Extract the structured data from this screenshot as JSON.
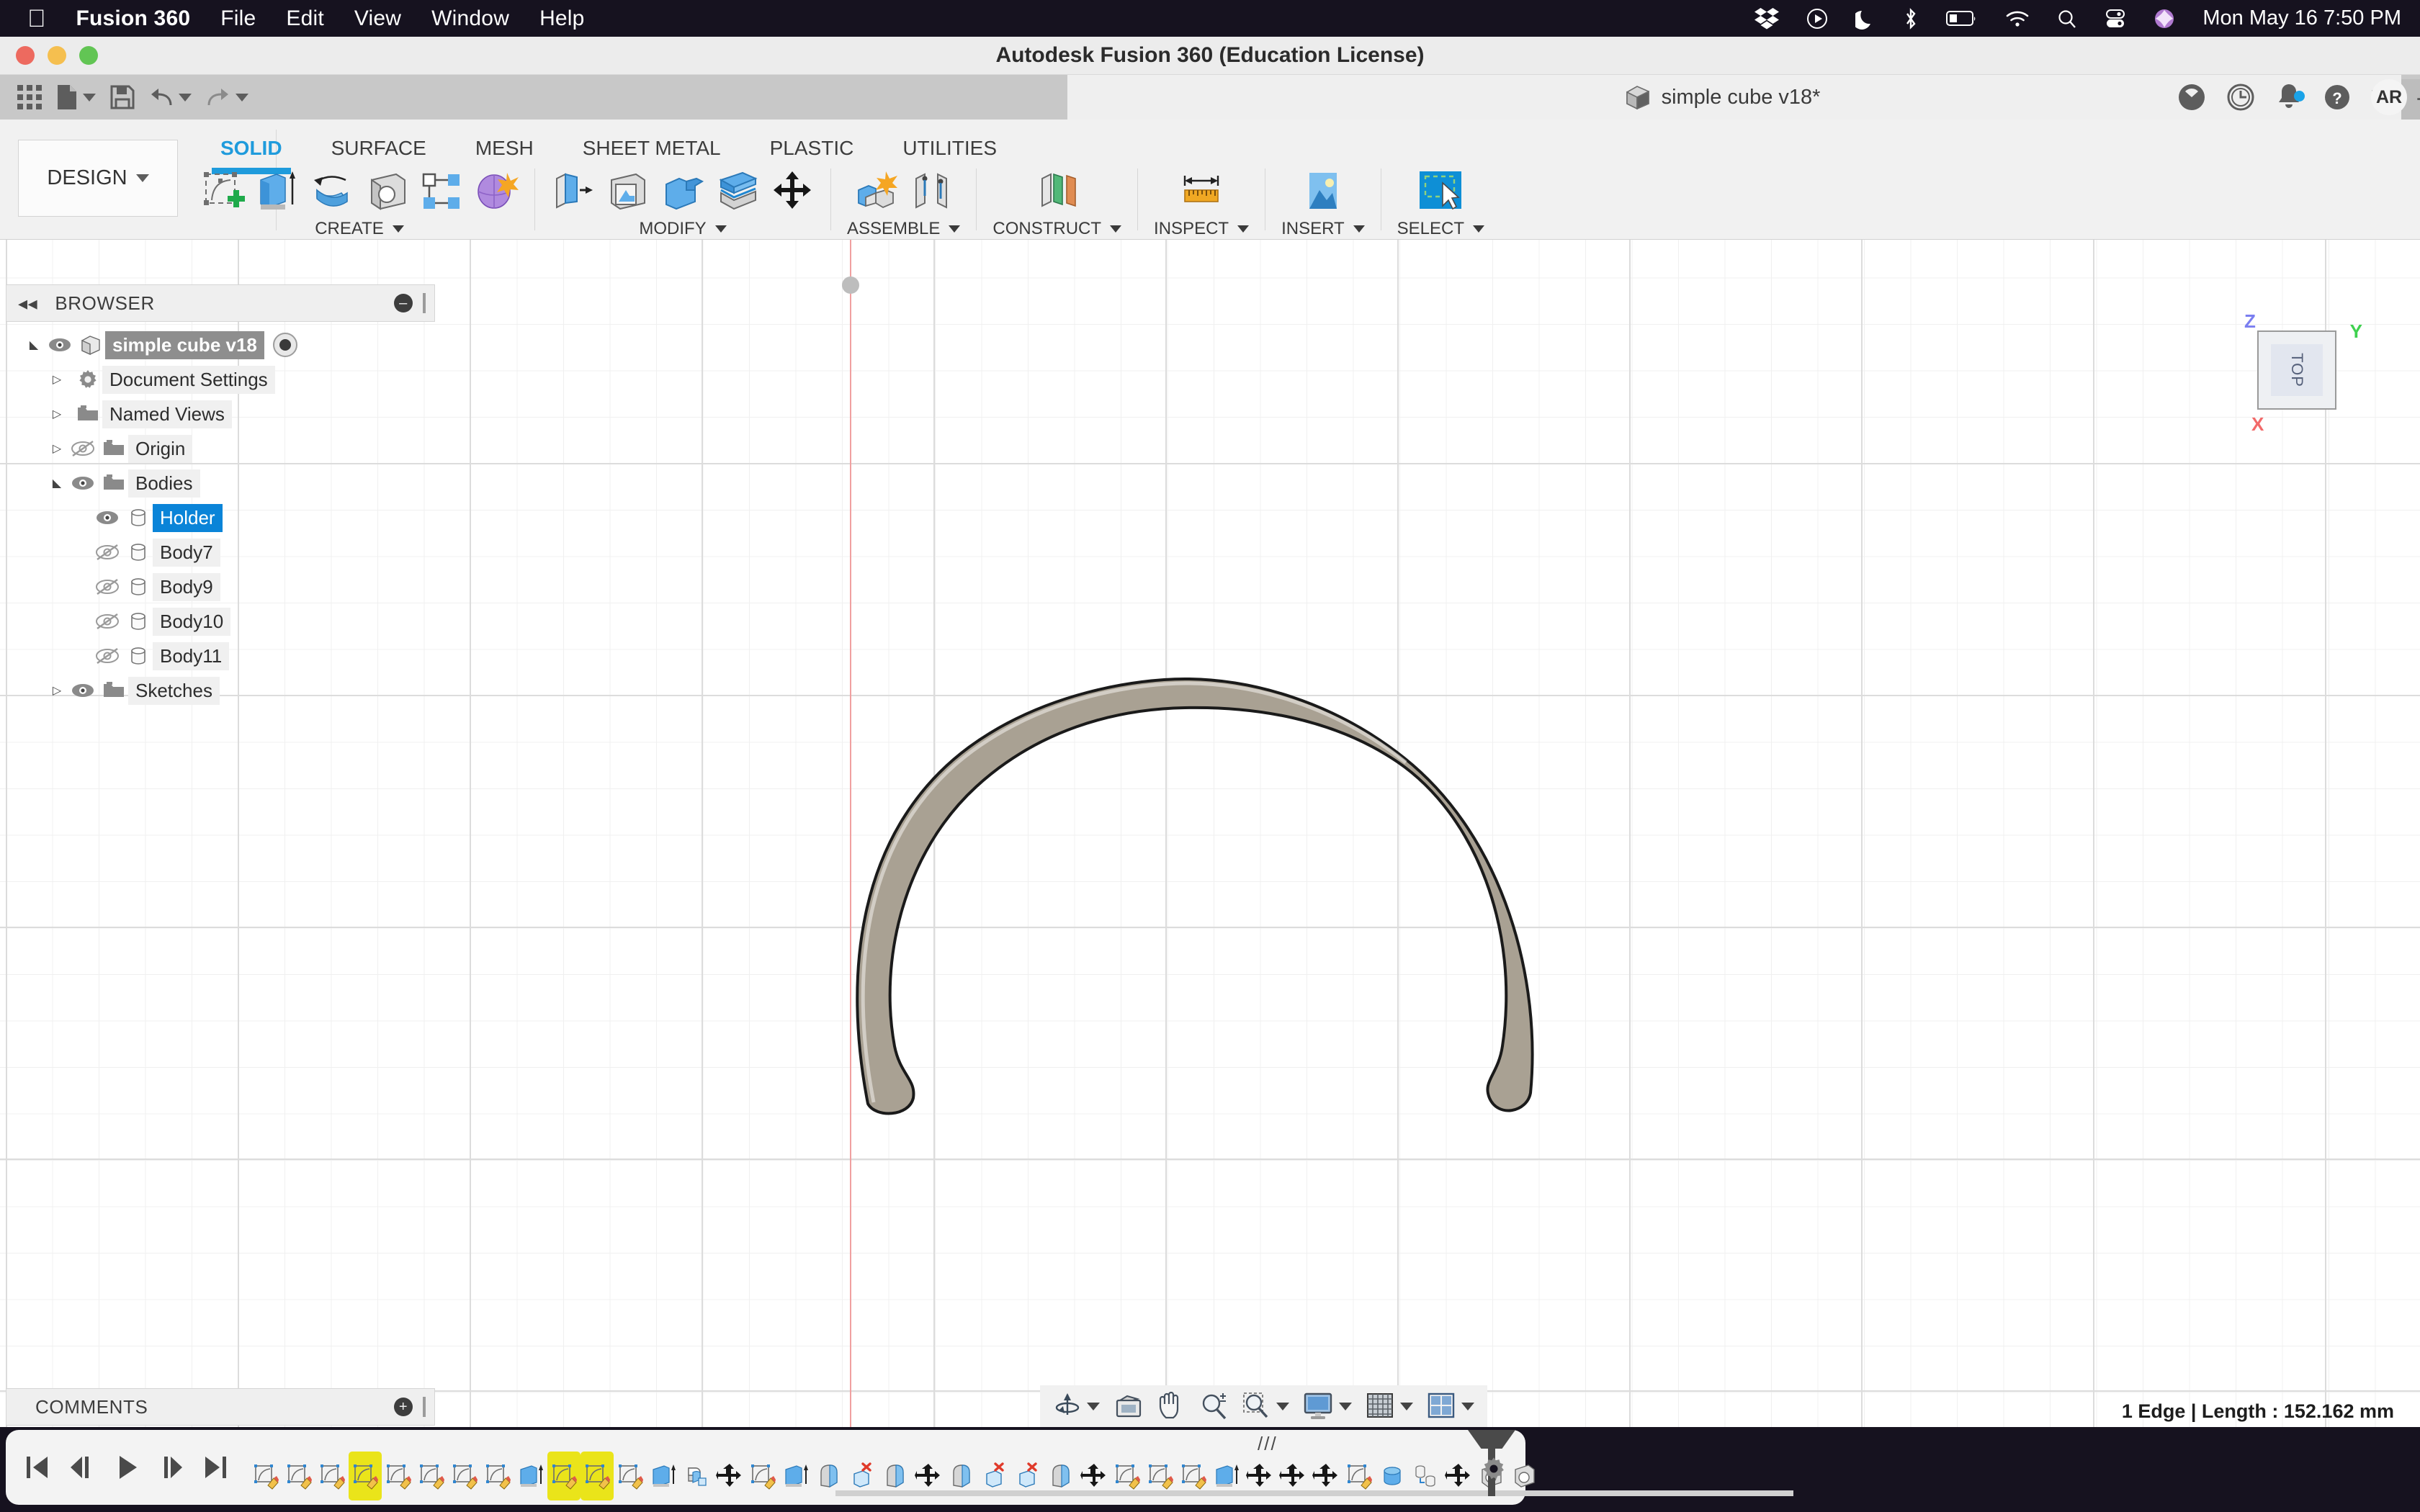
{
  "macos_menu": {
    "apple_icon": "apple-icon",
    "app_name": "Fusion 360",
    "items": [
      "File",
      "Edit",
      "View",
      "Window",
      "Help"
    ],
    "status_icons": [
      "dropbox-icon",
      "play-circle-icon",
      "moon-icon",
      "bluetooth-icon",
      "battery-icon",
      "wifi-icon",
      "search-icon",
      "control-center-icon",
      "siri-icon"
    ],
    "datetime": "Mon May 16  7:50 PM"
  },
  "window": {
    "title": "Autodesk Fusion 360 (Education License)",
    "traffic_lights": [
      "close",
      "minimize",
      "zoom"
    ]
  },
  "quick_access": {
    "items": [
      {
        "name": "show-data-panel-icon",
        "label": "Data Panel"
      },
      {
        "name": "file-icon",
        "label": "File"
      },
      {
        "name": "save-icon",
        "label": "Save"
      },
      {
        "name": "undo-icon",
        "label": "Undo"
      },
      {
        "name": "redo-icon",
        "label": "Redo"
      }
    ],
    "document_tab": "simple cube v18*",
    "document_tab_icon": "cube-icon",
    "close_tab": "✕",
    "new_tab": "+",
    "right_icons": [
      "extension-icon",
      "job-status-clock-icon",
      "notifications-bell-icon",
      "help-icon"
    ],
    "avatar_initials": "AR"
  },
  "ribbon": {
    "workspace": "DESIGN",
    "tabs": [
      {
        "label": "SOLID",
        "active": true
      },
      {
        "label": "SURFACE",
        "active": false
      },
      {
        "label": "MESH",
        "active": false
      },
      {
        "label": "SHEET METAL",
        "active": false
      },
      {
        "label": "PLASTIC",
        "active": false
      },
      {
        "label": "UTILITIES",
        "active": false
      }
    ],
    "groups": [
      {
        "label": "CREATE",
        "icons": [
          "create-sketch-icon",
          "extrude-icon",
          "revolve-icon",
          "hole-icon",
          "pattern-icon",
          "create-form-icon"
        ]
      },
      {
        "label": "MODIFY",
        "icons": [
          "press-pull-icon",
          "shell-icon",
          "combine-icon",
          "offset-face-icon",
          "move-copy-icon"
        ]
      },
      {
        "label": "ASSEMBLE",
        "icons": [
          "new-component-icon",
          "joint-icon"
        ]
      },
      {
        "label": "CONSTRUCT",
        "icons": [
          "offset-plane-icon"
        ]
      },
      {
        "label": "INSPECT",
        "icons": [
          "measure-icon"
        ]
      },
      {
        "label": "INSERT",
        "icons": [
          "insert-image-icon"
        ]
      },
      {
        "label": "SELECT",
        "icons": [
          "select-icon"
        ]
      }
    ]
  },
  "browser": {
    "title": "BROWSER",
    "collapse_icon": "collapse-left-icon",
    "pin_icon": "minimize-panel-icon",
    "tree": [
      {
        "label": "simple cube v18",
        "icon": "component-cube-icon",
        "visible": true,
        "expanded": true,
        "indent": 0,
        "root": true,
        "radio": true
      },
      {
        "label": "Document Settings",
        "icon": "gear-icon",
        "visible": null,
        "expanded": false,
        "indent": 1
      },
      {
        "label": "Named Views",
        "icon": "folder-icon",
        "visible": null,
        "expanded": false,
        "indent": 1
      },
      {
        "label": "Origin",
        "icon": "folder-icon",
        "visible": false,
        "expanded": false,
        "indent": 1
      },
      {
        "label": "Bodies",
        "icon": "folder-icon",
        "visible": true,
        "expanded": true,
        "indent": 1
      },
      {
        "label": "Holder",
        "icon": "body-icon",
        "visible": true,
        "expanded": null,
        "indent": 2,
        "selected": true
      },
      {
        "label": "Body7",
        "icon": "body-icon",
        "visible": false,
        "expanded": null,
        "indent": 2
      },
      {
        "label": "Body9",
        "icon": "body-icon",
        "visible": false,
        "expanded": null,
        "indent": 2
      },
      {
        "label": "Body10",
        "icon": "body-icon",
        "visible": false,
        "expanded": null,
        "indent": 2
      },
      {
        "label": "Body11",
        "icon": "body-icon",
        "visible": false,
        "expanded": null,
        "indent": 2
      },
      {
        "label": "Sketches",
        "icon": "folder-icon",
        "visible": true,
        "expanded": false,
        "indent": 1
      }
    ]
  },
  "comments": {
    "title": "COMMENTS",
    "pin_icon": "minimize-panel-icon"
  },
  "viewcube": {
    "face_label": "TOP",
    "axis_z": "Z",
    "axis_y": "Y",
    "axis_x": "X",
    "colors": {
      "z": "#7a7ef0",
      "y": "#3fd14f",
      "x": "#f26a6a"
    }
  },
  "canvas": {
    "model_name": "Holder",
    "model_color": "#a9a193",
    "model_outline": "#1a1a1a",
    "grid_minor_color": "#f0f0f0",
    "grid_major_color": "#dcdcdc",
    "x_axis_color": "#f0a0a0"
  },
  "navigation_bar": {
    "items": [
      {
        "name": "orbit-icon",
        "label": "Orbit",
        "has_caret": true
      },
      {
        "name": "look-at-icon",
        "label": "Look At",
        "has_caret": false
      },
      {
        "name": "pan-icon",
        "label": "Pan",
        "has_caret": false
      },
      {
        "name": "zoom-icon",
        "label": "Zoom",
        "has_caret": false
      },
      {
        "name": "zoom-window-icon",
        "label": "Fit",
        "has_caret": true
      },
      {
        "name": "display-settings-icon",
        "label": "Display Settings",
        "has_caret": true
      },
      {
        "name": "grid-snaps-icon",
        "label": "Grid and Snaps",
        "has_caret": true
      },
      {
        "name": "viewports-icon",
        "label": "Viewports",
        "has_caret": true
      }
    ]
  },
  "status_bar": {
    "selection_info": "1 Edge | Length : 152.162 mm"
  },
  "timeline": {
    "playback": [
      "jump-to-beginning-icon",
      "step-back-icon",
      "play-icon",
      "step-forward-icon",
      "jump-to-end-icon"
    ],
    "features": [
      {
        "icon": "sketch-icon",
        "highlight": false
      },
      {
        "icon": "sketch-icon",
        "highlight": false
      },
      {
        "icon": "sketch-icon",
        "highlight": false
      },
      {
        "icon": "sketch-icon",
        "highlight": true
      },
      {
        "icon": "sketch-icon",
        "highlight": false
      },
      {
        "icon": "sketch-icon",
        "highlight": false
      },
      {
        "icon": "sketch-icon",
        "highlight": false
      },
      {
        "icon": "sketch-icon",
        "highlight": false
      },
      {
        "icon": "extrude-icon",
        "highlight": false
      },
      {
        "icon": "sketch-icon",
        "highlight": true
      },
      {
        "icon": "sketch-icon",
        "highlight": true
      },
      {
        "icon": "sketch-icon",
        "highlight": false
      },
      {
        "icon": "extrude-icon",
        "highlight": false
      },
      {
        "icon": "fillet-icon",
        "highlight": false
      },
      {
        "icon": "move-icon",
        "highlight": false
      },
      {
        "icon": "sketch-icon",
        "highlight": false
      },
      {
        "icon": "extrude-icon",
        "highlight": false
      },
      {
        "icon": "loft-icon",
        "highlight": false
      },
      {
        "icon": "delete-body-icon",
        "highlight": false
      },
      {
        "icon": "loft-icon",
        "highlight": false
      },
      {
        "icon": "move-icon",
        "highlight": false
      },
      {
        "icon": "loft-icon",
        "highlight": false
      },
      {
        "icon": "delete-body-icon",
        "highlight": false
      },
      {
        "icon": "delete-body-icon",
        "highlight": false
      },
      {
        "icon": "loft-icon",
        "highlight": false
      },
      {
        "icon": "move-icon",
        "highlight": false
      },
      {
        "icon": "sketch-icon",
        "highlight": false
      },
      {
        "icon": "sketch-icon",
        "highlight": false
      },
      {
        "icon": "sketch-icon",
        "highlight": false
      },
      {
        "icon": "extrude-icon",
        "highlight": false
      },
      {
        "icon": "move-icon",
        "highlight": false
      },
      {
        "icon": "move-icon",
        "highlight": false
      },
      {
        "icon": "move-icon",
        "highlight": false
      },
      {
        "icon": "sketch-icon",
        "highlight": false
      },
      {
        "icon": "cylinder-icon",
        "highlight": false
      },
      {
        "icon": "copy-body-icon",
        "highlight": false
      },
      {
        "icon": "move-icon",
        "highlight": false
      },
      {
        "icon": "hole-icon",
        "highlight": false
      },
      {
        "icon": "hole-icon",
        "highlight": false
      }
    ],
    "settings_icon": "gear-icon"
  }
}
